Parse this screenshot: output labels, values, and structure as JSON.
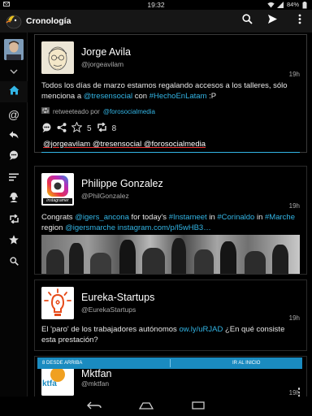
{
  "status_bar": {
    "time": "19:32",
    "battery": "84%"
  },
  "app": {
    "title": "Cronología"
  },
  "sidebar": {
    "items": [
      {
        "icon": "home-icon",
        "active": true
      },
      {
        "icon": "mention-icon"
      },
      {
        "icon": "reply-icon"
      },
      {
        "icon": "message-icon"
      },
      {
        "icon": "lists-icon"
      },
      {
        "icon": "user-icon"
      },
      {
        "icon": "retweet-icon"
      },
      {
        "icon": "star-icon"
      },
      {
        "icon": "search-icon"
      }
    ]
  },
  "tweets": [
    {
      "name": "Jorge Avila",
      "handle": "@jorgeavilam",
      "time": "19h",
      "text_parts": [
        {
          "t": "Todos los días de marzo estamos regalando accesos a los talleres, sólo menciona a "
        },
        {
          "t": "@tresensocial",
          "link": true
        },
        {
          "t": " con "
        },
        {
          "t": "#HechoEnLatam",
          "link": true
        },
        {
          "t": " :P"
        }
      ],
      "retweeted_prefix": "retweeteado por",
      "retweeted_by": "@forosocialmedia",
      "retweet_count": "5",
      "favorite_count": "8",
      "reply_text": "@jorgeavilam @tresensocial @forosocialmedia"
    },
    {
      "name": "Philippe Gonzalez",
      "handle": "@PhilGonzalez",
      "time": "19h",
      "avatar_label": "instagramer",
      "text_parts": [
        {
          "t": "Congrats "
        },
        {
          "t": "@igers_ancona",
          "link": true
        },
        {
          "t": " for today's "
        },
        {
          "t": "#Instameet",
          "link": true
        },
        {
          "t": " in "
        },
        {
          "t": "#Corinaldo",
          "link": true
        },
        {
          "t": " in "
        },
        {
          "t": "#Marche",
          "link": true
        },
        {
          "t": " region "
        },
        {
          "t": "@igersmarche",
          "link": true
        },
        {
          "t": " "
        },
        {
          "t": "instagram.com/p/l5wHB3…",
          "link": true
        }
      ]
    },
    {
      "name": "Eureka-Startups",
      "handle": "@EurekaStartups",
      "time": "19h",
      "text_parts": [
        {
          "t": "El 'paro' de los trabajadores autónomos "
        },
        {
          "t": "ow.ly/uRJAD",
          "link": true
        },
        {
          "t": " ¿En qué consiste esta prestación?"
        }
      ]
    },
    {
      "name": "Mktfan",
      "handle": "@mktfan",
      "time": "19h",
      "avatar_label": "ktfa"
    }
  ],
  "new_tweets_bar": {
    "left_label": "8 DESDE ARRIBA",
    "right_label": "IR AL INICIO"
  },
  "colors": {
    "accent": "#33b5e5",
    "bar": "#1a8bc0",
    "background": "#000000"
  }
}
